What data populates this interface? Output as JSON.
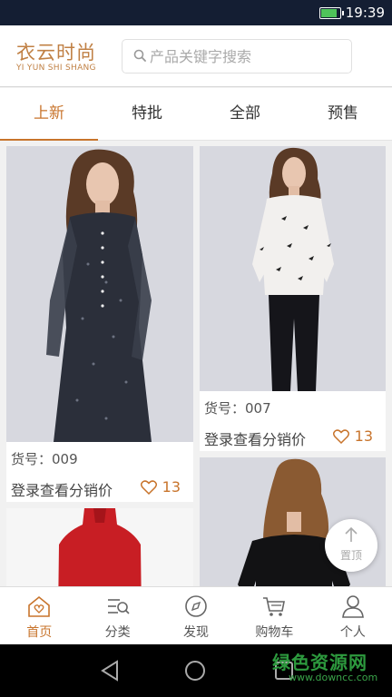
{
  "status_bar": {
    "time": "19:39",
    "battery_icon": "battery-charging-icon"
  },
  "header": {
    "logo_cn": "衣云时尚",
    "logo_en": "YI YUN SHI SHANG",
    "search_placeholder": "产品关键字搜索",
    "search_value": ""
  },
  "tabs": [
    {
      "label": "上新",
      "active": true
    },
    {
      "label": "特批",
      "active": false
    },
    {
      "label": "全部",
      "active": false
    },
    {
      "label": "预售",
      "active": false
    }
  ],
  "products": [
    {
      "sku_label": "货号：009",
      "price_prompt": "登录查看分销价",
      "likes": "13"
    },
    {
      "sku_label": "货号：007",
      "price_prompt": "登录查看分销价",
      "likes": "13"
    }
  ],
  "back_to_top": {
    "label": "置顶",
    "icon": "arrow-up-icon"
  },
  "bottom_nav": [
    {
      "label": "首页",
      "icon": "home-icon",
      "active": true
    },
    {
      "label": "分类",
      "icon": "category-icon",
      "active": false
    },
    {
      "label": "发现",
      "icon": "compass-icon",
      "active": false
    },
    {
      "label": "购物车",
      "icon": "cart-icon",
      "active": false
    },
    {
      "label": "个人",
      "icon": "person-icon",
      "active": false
    }
  ],
  "watermark": {
    "cn": "绿色资源网",
    "en": "www.downcc.com"
  },
  "colors": {
    "accent": "#c8742c",
    "status_bar": "#141e33",
    "photo_bg": "#d6d7de"
  }
}
